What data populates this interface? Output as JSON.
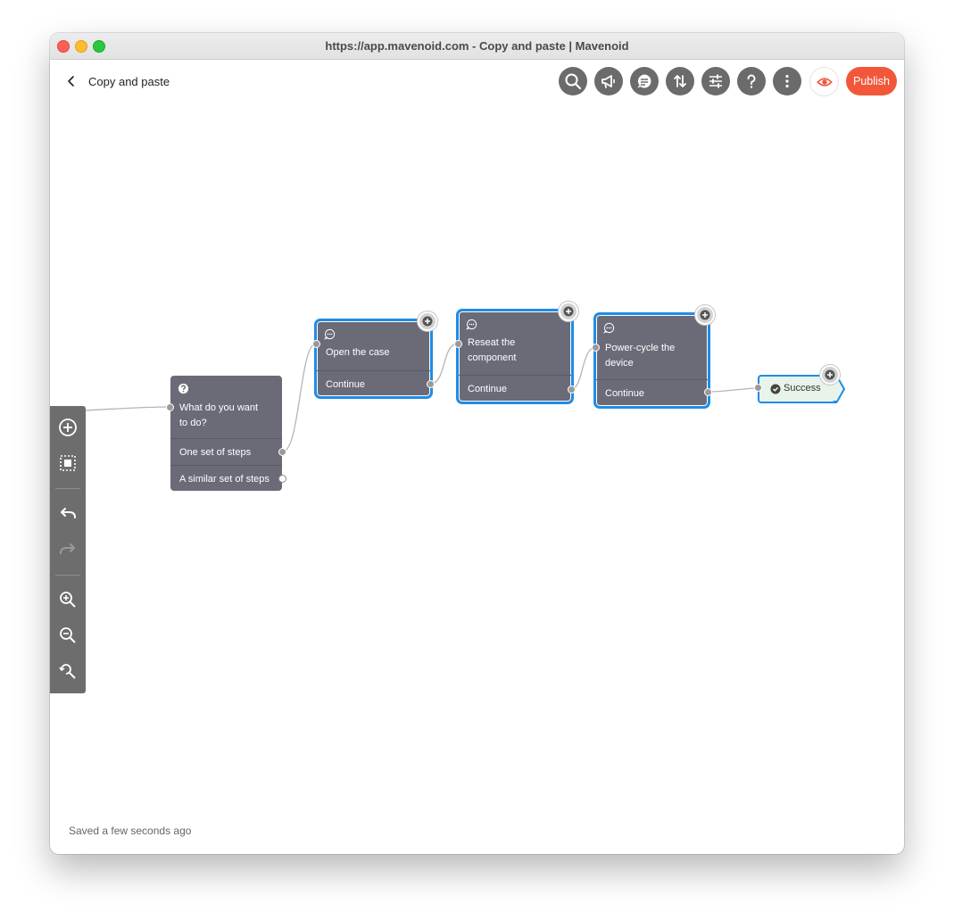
{
  "window": {
    "title": "https://app.mavenoid.com - Copy and paste | Mavenoid"
  },
  "header": {
    "page_title": "Copy and paste",
    "toolbar": [
      {
        "name": "search-button",
        "icon": "search-icon"
      },
      {
        "name": "announcement-button",
        "icon": "megaphone-icon"
      },
      {
        "name": "chat-button",
        "icon": "chat-bubble-icon"
      },
      {
        "name": "import-export-button",
        "icon": "up-down-arrows-icon"
      },
      {
        "name": "settings-button",
        "icon": "sliders-icon"
      },
      {
        "name": "help-button",
        "icon": "question-icon"
      },
      {
        "name": "more-button",
        "icon": "vertical-dots-icon"
      }
    ],
    "preview_icon": "eye-icon",
    "publish_label": "Publish"
  },
  "colors": {
    "accent": "#f2573a",
    "selection": "#1f8ce6",
    "node_bg": "#6b6b78",
    "toolbar_bg": "#6b6b6b",
    "success_bg": "#e8f4ea"
  },
  "nodes": {
    "question": {
      "title_line1": "What do you want",
      "title_line2": "to do?",
      "options": [
        "One set of steps",
        "A similar set of steps"
      ]
    },
    "step1": {
      "title_line1": "Open the case",
      "option": "Continue"
    },
    "step2": {
      "title_line1": "Reseat the",
      "title_line2": "component",
      "option": "Continue"
    },
    "step3": {
      "title_line1": "Power-cycle the",
      "title_line2": "device",
      "option": "Continue"
    },
    "success": {
      "label": "Success"
    }
  },
  "footer": {
    "saved_status": "Saved a few seconds ago"
  }
}
